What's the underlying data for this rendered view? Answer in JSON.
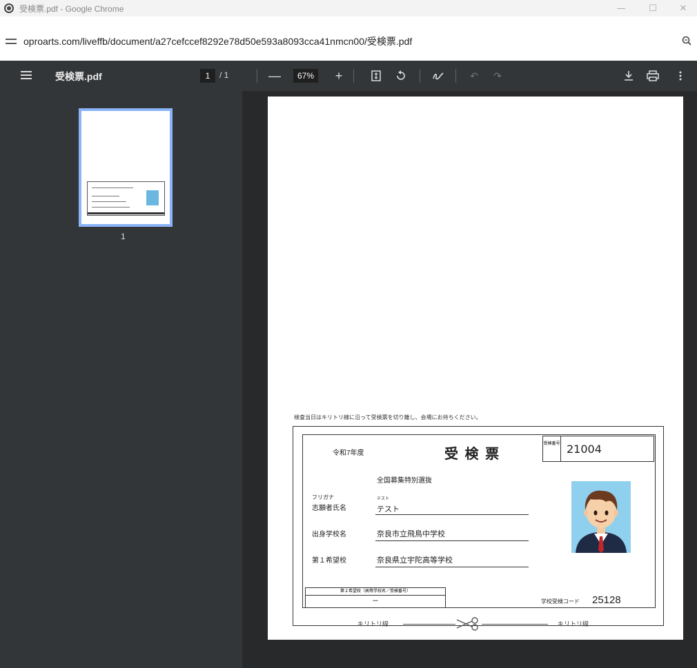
{
  "window": {
    "title": "受検票.pdf - Google Chrome",
    "controls": {
      "minimize": "—",
      "maximize": "☐",
      "close": "✕"
    }
  },
  "address_bar": {
    "url": "oproarts.com/liveffb/document/a27cefccef8292e78d50e593a8093cca41nmcn00/受検票.pdf"
  },
  "pdf_toolbar": {
    "doc_title": "受検票.pdf",
    "current_page": "1",
    "page_separator": "/ 1",
    "zoom": "67%",
    "zoom_out": "—",
    "zoom_in": "+"
  },
  "sidebar": {
    "thumbnail_label": "1"
  },
  "ticket": {
    "instruction": "検査当日はキリトリ線に沿って受検票を切り離し、会場にお持ちください。",
    "year": "令和7年度",
    "title": "受 検 票",
    "exam_no_label": "受検番号",
    "exam_no": "21004",
    "category": "全国募集特別選抜",
    "furigana_label": "フリガナ",
    "name_label": "志願者氏名",
    "furigana": "テスト",
    "name": "テスト",
    "school_label": "出身学校名",
    "school": "奈良市立飛鳥中学校",
    "first_choice_label": "第１希望校",
    "first_choice": "奈良県立宇陀高等学校",
    "second_choice_header": "第２希望校（高等学校名／受検番号）",
    "second_choice_value": "－",
    "code_label": "学校受検コード",
    "code": "25128",
    "cut_label_left": "キリトリ線",
    "cut_label_right": "キリトリ線"
  }
}
